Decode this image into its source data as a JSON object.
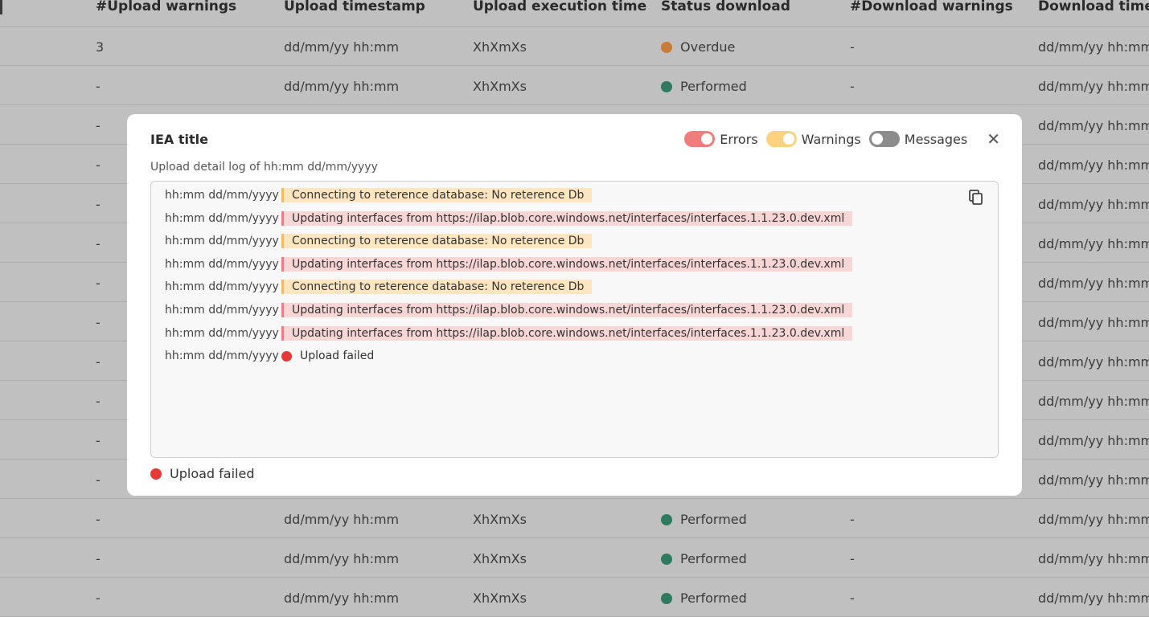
{
  "table": {
    "headers": [
      "#Upload warnings",
      "Upload timestamp",
      "Upload execution time",
      "Status download",
      "#Download warnings",
      "Download times"
    ],
    "rows": [
      {
        "upload_warnings": "3",
        "upload_timestamp": "dd/mm/yy hh:mm",
        "exec_time": "XhXmXs",
        "status": "Overdue",
        "status_color": "#c97c37",
        "download_warnings": "-",
        "download_timestamp": "dd/mm/yy hh:mm"
      },
      {
        "upload_warnings": "-",
        "upload_timestamp": "dd/mm/yy hh:mm",
        "exec_time": "XhXmXs",
        "status": "Performed",
        "status_color": "#2f7b60",
        "download_warnings": "-",
        "download_timestamp": "dd/mm/yy hh:mm"
      },
      {
        "upload_warnings": "-",
        "upload_timestamp": "",
        "exec_time": "",
        "status": "",
        "status_color": "",
        "download_warnings": "",
        "download_timestamp": "dd/mm/yy hh:mm"
      },
      {
        "upload_warnings": "-",
        "upload_timestamp": "",
        "exec_time": "",
        "status": "",
        "status_color": "",
        "download_warnings": "",
        "download_timestamp": "dd/mm/yy hh:mm"
      },
      {
        "upload_warnings": "-",
        "upload_timestamp": "",
        "exec_time": "",
        "status": "",
        "status_color": "",
        "download_warnings": "",
        "download_timestamp": "dd/mm/yy hh:mm"
      },
      {
        "upload_warnings": "-",
        "upload_timestamp": "",
        "exec_time": "",
        "status": "",
        "status_color": "",
        "download_warnings": "",
        "download_timestamp": "dd/mm/yy hh:mm"
      },
      {
        "upload_warnings": "-",
        "upload_timestamp": "",
        "exec_time": "",
        "status": "",
        "status_color": "",
        "download_warnings": "",
        "download_timestamp": "dd/mm/yy hh:mm"
      },
      {
        "upload_warnings": "-",
        "upload_timestamp": "",
        "exec_time": "",
        "status": "",
        "status_color": "",
        "download_warnings": "",
        "download_timestamp": "dd/mm/yy hh:mm"
      },
      {
        "upload_warnings": "-",
        "upload_timestamp": "",
        "exec_time": "",
        "status": "",
        "status_color": "",
        "download_warnings": "",
        "download_timestamp": "dd/mm/yy hh:mm"
      },
      {
        "upload_warnings": "-",
        "upload_timestamp": "",
        "exec_time": "",
        "status": "",
        "status_color": "",
        "download_warnings": "",
        "download_timestamp": "dd/mm/yy hh:mm"
      },
      {
        "upload_warnings": "-",
        "upload_timestamp": "",
        "exec_time": "",
        "status": "",
        "status_color": "",
        "download_warnings": "",
        "download_timestamp": "dd/mm/yy hh:mm"
      },
      {
        "upload_warnings": "-",
        "upload_timestamp": "",
        "exec_time": "",
        "status": "",
        "status_color": "",
        "download_warnings": "",
        "download_timestamp": "dd/mm/yy hh:mm"
      },
      {
        "upload_warnings": "-",
        "upload_timestamp": "dd/mm/yy hh:mm",
        "exec_time": "XhXmXs",
        "status": "Performed",
        "status_color": "#2f7b60",
        "download_warnings": "-",
        "download_timestamp": "dd/mm/yy hh:mm"
      },
      {
        "upload_warnings": "-",
        "upload_timestamp": "dd/mm/yy hh:mm",
        "exec_time": "XhXmXs",
        "status": "Performed",
        "status_color": "#2f7b60",
        "download_warnings": "-",
        "download_timestamp": "dd/mm/yy hh:mm"
      },
      {
        "upload_warnings": "-",
        "upload_timestamp": "dd/mm/yy hh:mm",
        "exec_time": "XhXmXs",
        "status": "Performed",
        "status_color": "#2f7b60",
        "download_warnings": "-",
        "download_timestamp": "dd/mm/yy hh:mm"
      }
    ]
  },
  "modal": {
    "title": "IEA title",
    "toggles": {
      "errors": {
        "label": "Errors",
        "on": true,
        "color": "#f07c7c"
      },
      "warnings": {
        "label": "Warnings",
        "on": true,
        "color": "#ffd27f"
      },
      "messages": {
        "label": "Messages",
        "on": false,
        "color": "#8c8c8c"
      }
    },
    "close_icon": "close-icon",
    "log_caption": "Upload detail log of hh:mm dd/mm/yyyy",
    "copy_icon": "copy-icon",
    "log": [
      {
        "time": "hh:mm dd/mm/yyyy",
        "type": "warning",
        "text": "Connecting to reterence database: No reterence Db"
      },
      {
        "time": "hh:mm dd/mm/yyyy",
        "type": "error",
        "text": "Updating interfaces from https://ilap.blob.core.windows.net/interfaces/interfaces.1.1.23.0.dev.xml"
      },
      {
        "time": "hh:mm dd/mm/yyyy",
        "type": "warning",
        "text": "Connecting to reterence database: No reterence Db"
      },
      {
        "time": "hh:mm dd/mm/yyyy",
        "type": "error",
        "text": "Updating interfaces from https://ilap.blob.core.windows.net/interfaces/interfaces.1.1.23.0.dev.xml"
      },
      {
        "time": "hh:mm dd/mm/yyyy",
        "type": "warning",
        "text": "Connecting to reterence database: No reterence Db"
      },
      {
        "time": "hh:mm dd/mm/yyyy",
        "type": "error",
        "text": "Updating interfaces from https://ilap.blob.core.windows.net/interfaces/interfaces.1.1.23.0.dev.xml"
      },
      {
        "time": "hh:mm dd/mm/yyyy",
        "type": "error",
        "text": "Updating interfaces from https://ilap.blob.core.windows.net/interfaces/interfaces.1.1.23.0.dev.xml"
      },
      {
        "time": "hh:mm dd/mm/yyyy",
        "type": "failure",
        "text": "Upload failed"
      }
    ],
    "footer_status": "Upload failed",
    "failure_color": "#e53935"
  }
}
